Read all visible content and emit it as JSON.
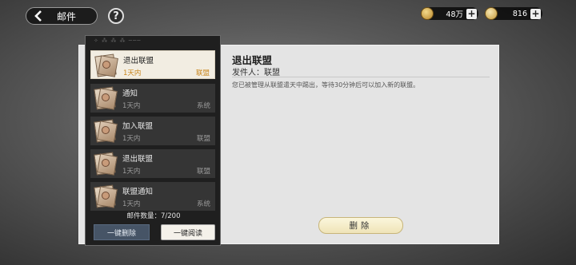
{
  "header": {
    "back_icon": "chevron-left-icon",
    "title": "邮件",
    "help_icon": "help-icon",
    "help_label": "?"
  },
  "resources": [
    {
      "name": "gold-coin-icon",
      "value": "48万",
      "plus": "+"
    },
    {
      "name": "gem-currency-icon",
      "value": "816",
      "plus": "+"
    }
  ],
  "mail_list": {
    "items": [
      {
        "title": "退出联盟",
        "time": "1天内",
        "sender": "联盟",
        "selected": true
      },
      {
        "title": "通知",
        "time": "1天内",
        "sender": "系统",
        "selected": false
      },
      {
        "title": "加入联盟",
        "time": "1天内",
        "sender": "联盟",
        "selected": false
      },
      {
        "title": "退出联盟",
        "time": "1天内",
        "sender": "联盟",
        "selected": false
      },
      {
        "title": "联盟通知",
        "time": "1天内",
        "sender": "系统",
        "selected": false
      }
    ],
    "count_label": "邮件数量：7/200",
    "delete_all_label": "一键删除",
    "read_all_label": "一键阅读"
  },
  "detail": {
    "title": "退出联盟",
    "sender_line": "发件人：联盟",
    "body": "您已被管理从联盟遣天中踢出，等待30分钟后可以加入新的联盟。",
    "delete_label": "删除"
  },
  "colors": {
    "selected_accent": "#c9861d",
    "delete_all_bg": "#465466"
  }
}
